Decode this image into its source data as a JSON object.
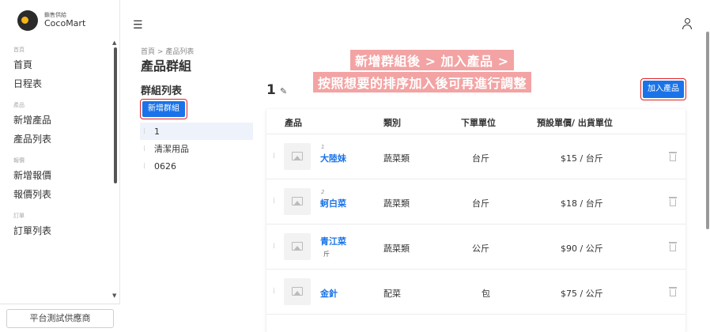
{
  "brand": {
    "subtitle": "鎖售供給",
    "name": "CocoMart"
  },
  "sidebar": {
    "sections": [
      {
        "label": "首頁",
        "items": [
          "首頁",
          "日程表"
        ]
      },
      {
        "label": "產品",
        "items": [
          "新增產品",
          "產品列表"
        ]
      },
      {
        "label": "報價",
        "items": [
          "新增報價",
          "報價列表"
        ]
      },
      {
        "label": "訂單",
        "items": [
          "訂單列表"
        ]
      }
    ],
    "footer_button": "平台測試供應商"
  },
  "header": {
    "menu_icon": "menu-collapse-icon",
    "user_icon": "user-icon"
  },
  "breadcrumb": [
    "首頁",
    "產品列表"
  ],
  "breadcrumb_sep": ">",
  "page_title": "產品群組",
  "annotation": {
    "line1": "新增群組後 > 加入產品 >",
    "line2": "按照想要的排序加入後可再進行調整",
    "color": "#f3a3a3"
  },
  "groups": {
    "title": "群組列表",
    "add_button": "新增群組",
    "items": [
      "1",
      "清潔用品",
      "0626"
    ],
    "selected": "1"
  },
  "detail": {
    "group_name": "1",
    "add_product_button": "加入產品",
    "columns": [
      "產品",
      "類別",
      "下單單位",
      "預設單價/ 出貨單位"
    ],
    "rows": [
      {
        "seq": "1",
        "name": "大陸妹",
        "sub": "",
        "category": "蔬菜類",
        "unit": "台斤",
        "price": "$15 / 台斤"
      },
      {
        "seq": "2",
        "name": "蚵白菜",
        "sub": "",
        "category": "蔬菜類",
        "unit": "台斤",
        "price": "$18 / 台斤"
      },
      {
        "seq": "",
        "name": "青江菜",
        "sub": "斤",
        "category": "蔬菜類",
        "unit": "公斤",
        "price": "$90 / 公斤"
      },
      {
        "seq": "",
        "name": "金針",
        "sub": "",
        "category": "配菜",
        "unit": "包",
        "price": "$75 / 公斤"
      }
    ]
  },
  "colors": {
    "primary": "#1a73e8",
    "highlight_border": "#e02020"
  }
}
